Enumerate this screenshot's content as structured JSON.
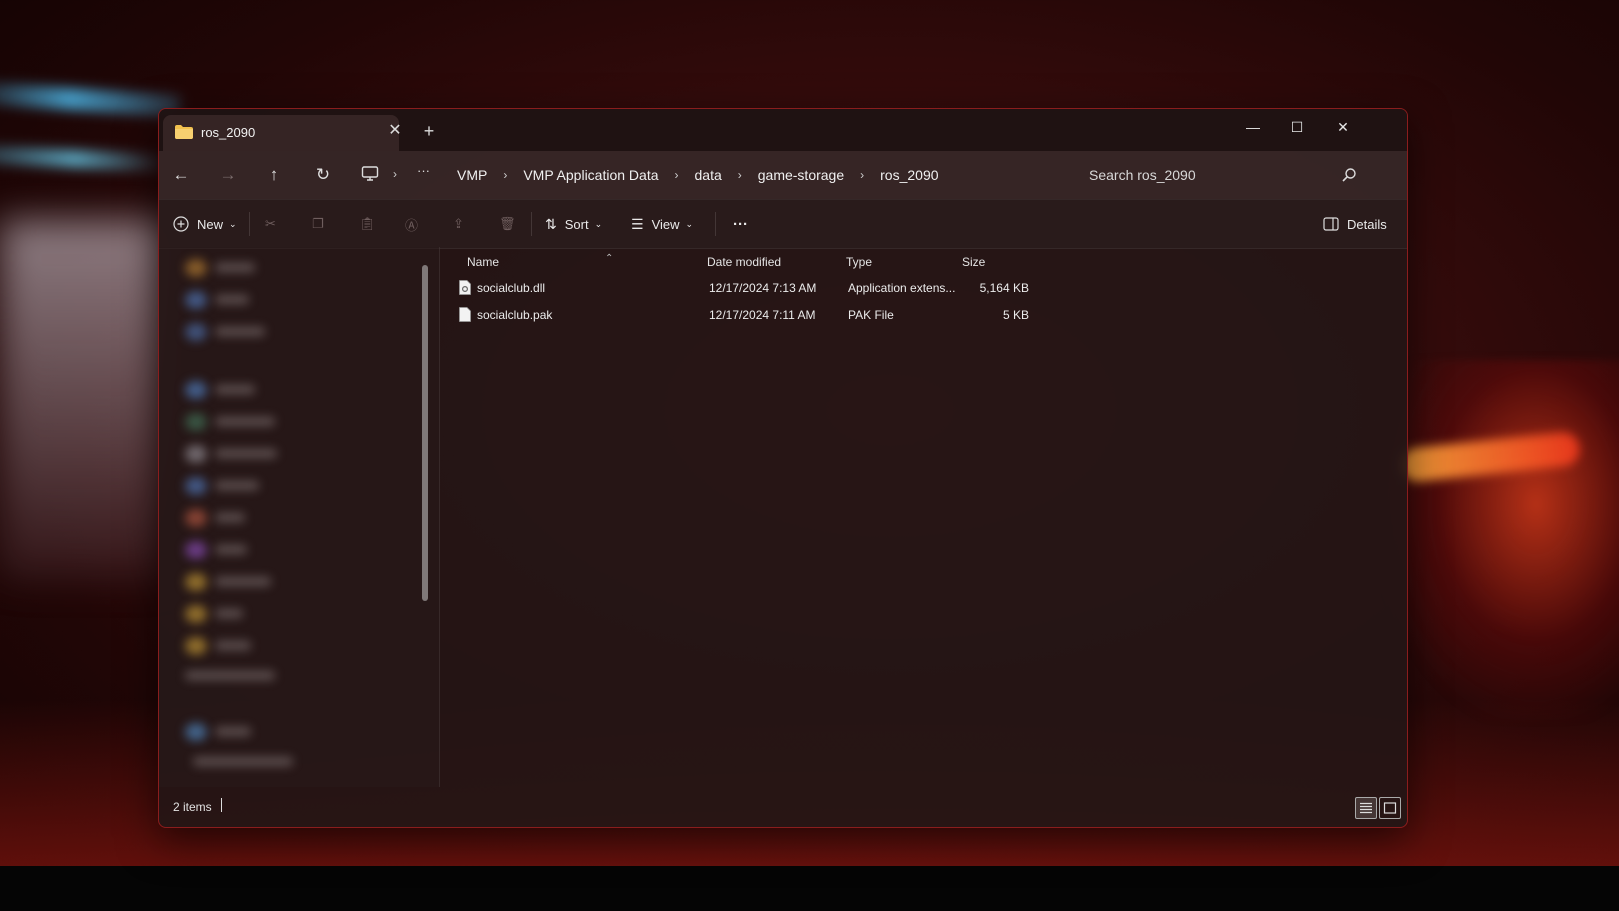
{
  "window": {
    "tab_title": "ros_2090",
    "new_tab": "+",
    "minimize": "—",
    "maximize": "☐",
    "close": "✕"
  },
  "nav": {
    "back": "←",
    "forward": "→",
    "up": "↑",
    "refresh": "↻",
    "more": "···",
    "breadcrumbs": [
      "VMP",
      "VMP Application Data",
      "data",
      "game-storage",
      "ros_2090"
    ],
    "search_placeholder": "Search ros_2090"
  },
  "toolbar": {
    "new_label": "New",
    "sort_label": "Sort",
    "view_label": "View",
    "more": "···",
    "details_label": "Details"
  },
  "columns": {
    "name": "Name",
    "date": "Date modified",
    "type": "Type",
    "size": "Size"
  },
  "files": [
    {
      "name": "socialclub.dll",
      "date": "12/17/2024 7:13 AM",
      "type": "Application extens...",
      "size": "5,164 KB",
      "icon": "dll-file-icon"
    },
    {
      "name": "socialclub.pak",
      "date": "12/17/2024 7:11 AM",
      "type": "PAK File",
      "size": "5 KB",
      "icon": "file-icon"
    }
  ],
  "status": {
    "item_count": "2 items"
  },
  "colors": {
    "window_border": "#8a1d1d",
    "folder": "#f2c14e"
  }
}
